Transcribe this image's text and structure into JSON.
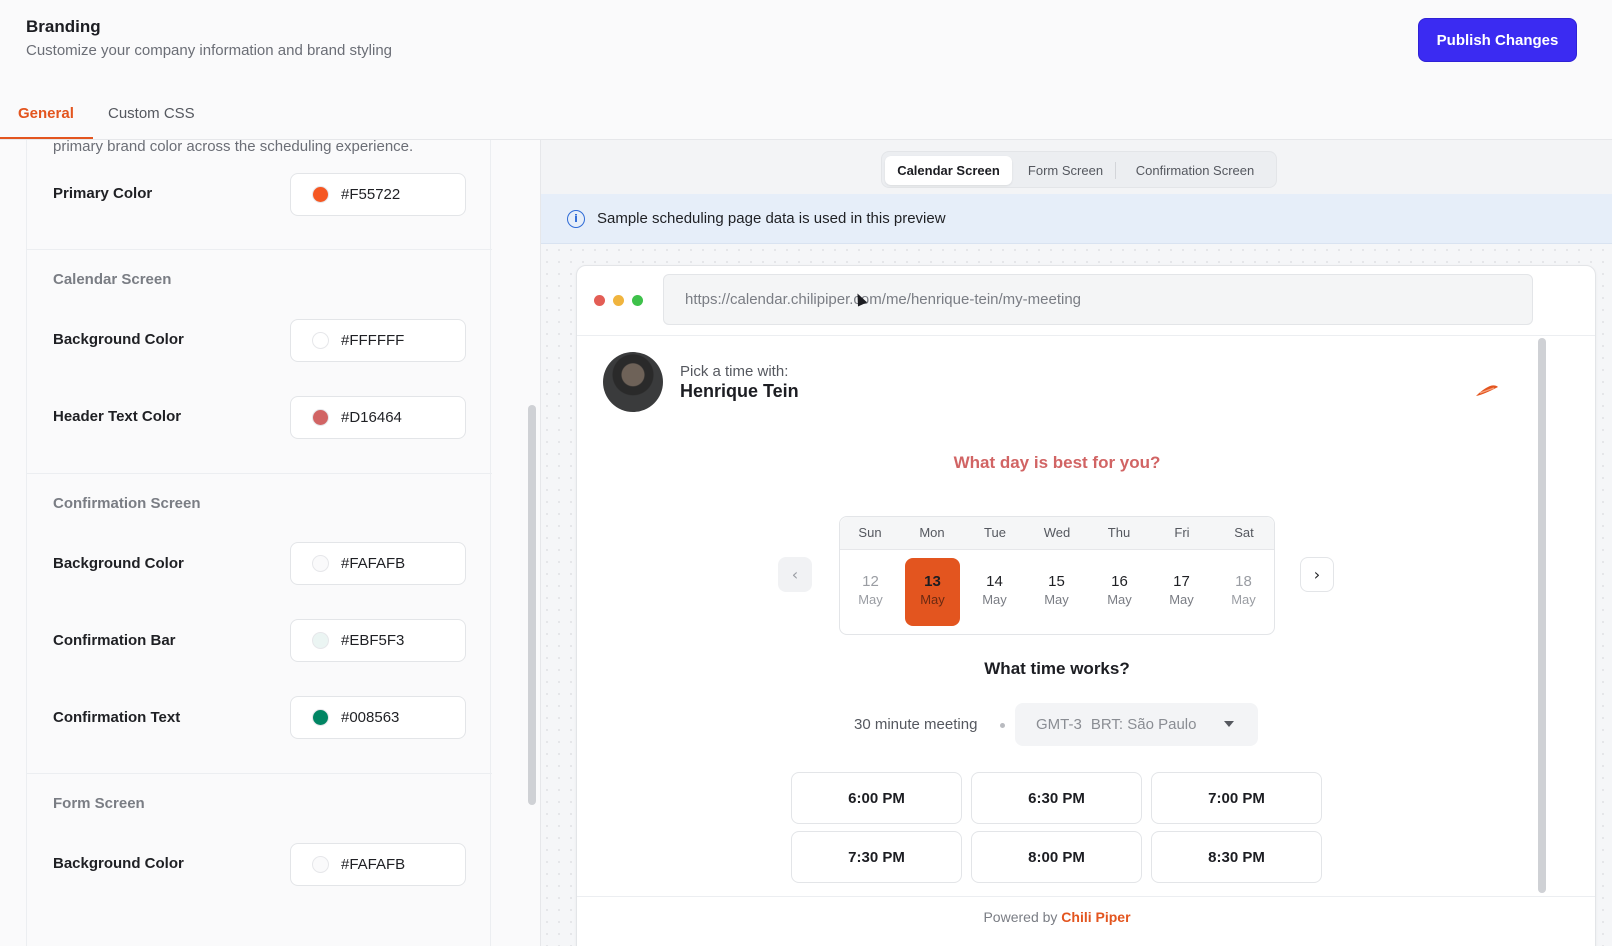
{
  "header": {
    "title": "Branding",
    "subtitle": "Customize your company information and brand styling",
    "publish_label": "Publish Changes"
  },
  "tabs": [
    {
      "label": "General",
      "active": true
    },
    {
      "label": "Custom CSS",
      "active": false
    }
  ],
  "left_panel": {
    "intro": "primary brand color across the scheduling experience.",
    "primary": {
      "label": "Primary Color",
      "value": "#F55722",
      "swatch": "#F55722"
    },
    "calendar_section": {
      "title": "Calendar Screen",
      "fields": [
        {
          "label": "Background Color",
          "value": "#FFFFFF",
          "swatch": "#FFFFFF"
        },
        {
          "label": "Header Text Color",
          "value": "#D16464",
          "swatch": "#D16464"
        }
      ]
    },
    "confirmation_section": {
      "title": "Confirmation Screen",
      "fields": [
        {
          "label": "Background Color",
          "value": "#FAFAFB",
          "swatch": "#FAFAFB"
        },
        {
          "label": "Confirmation Bar",
          "value": "#EBF5F3",
          "swatch": "#EBF5F3"
        },
        {
          "label": "Confirmation Text",
          "value": "#008563",
          "swatch": "#008563"
        }
      ]
    },
    "form_section": {
      "title": "Form Screen",
      "fields": [
        {
          "label": "Background Color",
          "value": "#FAFAFB",
          "swatch": "#FAFAFB"
        }
      ]
    }
  },
  "preview": {
    "screen_tabs": [
      {
        "label": "Calendar Screen",
        "active": true
      },
      {
        "label": "Form Screen",
        "active": false
      },
      {
        "label": "Confirmation Screen",
        "active": false
      }
    ],
    "info_text": "Sample scheduling page data is used in this preview",
    "url": "https://calendar.chilipiper.com/me/henrique-tein/my-meeting",
    "pick_label": "Pick a time with:",
    "host_name": "Henrique Tein",
    "question": "What day is best for you?",
    "weekdays": [
      "Sun",
      "Mon",
      "Tue",
      "Wed",
      "Thu",
      "Fri",
      "Sat"
    ],
    "days": [
      {
        "num": "12",
        "month": "May",
        "state": "disabled"
      },
      {
        "num": "13",
        "month": "May",
        "state": "selected"
      },
      {
        "num": "14",
        "month": "May",
        "state": "normal"
      },
      {
        "num": "15",
        "month": "May",
        "state": "normal"
      },
      {
        "num": "16",
        "month": "May",
        "state": "normal"
      },
      {
        "num": "17",
        "month": "May",
        "state": "normal"
      },
      {
        "num": "18",
        "month": "May",
        "state": "disabled"
      }
    ],
    "time_question": "What time works?",
    "duration": "30 minute meeting",
    "timezone_offset": "GMT-3",
    "timezone_name": "BRT: São Paulo",
    "slots": [
      "6:00 PM",
      "6:30 PM",
      "7:00 PM",
      "7:30 PM",
      "8:00 PM",
      "8:30 PM"
    ],
    "powered_prefix": "Powered by",
    "powered_brand": "Chili Piper"
  },
  "colors": {
    "accent": "#e3551f",
    "publish": "#3b2bf2",
    "header_text": "#d16464"
  }
}
